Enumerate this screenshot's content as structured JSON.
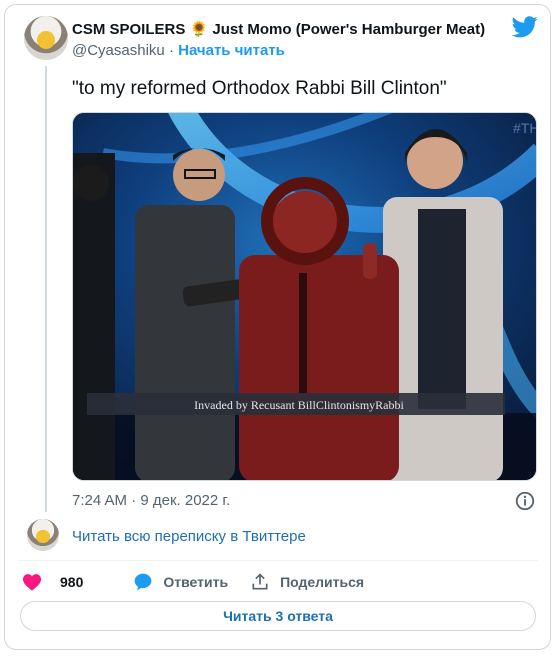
{
  "author": {
    "display_name": "CSM SPOILERS 🌻 Just Momo (Power's Hamburger Meat)",
    "handle": "@Cyasashiku",
    "separator": "·",
    "follow_label": "Начать читать"
  },
  "tweet": {
    "text": "\"to my reformed Orthodox Rabbi Bill Clinton\"",
    "media": {
      "corner_text": "#TH",
      "caption": "Invaded by Recusant BillClintonismyRabbi"
    },
    "timestamp": "7:24 AM · 9 дек. 2022 г."
  },
  "thread": {
    "read_label": "Читать всю переписку в Твиттере"
  },
  "actions": {
    "like_count": "980",
    "reply_label": "Ответить",
    "share_label": "Поделиться"
  },
  "replies_button": {
    "label": "Читать 3 ответа"
  },
  "colors": {
    "brand_blue": "#1d9bf0",
    "link_blue": "#1d6fb3",
    "like_pink": "#f91880",
    "muted": "#536471"
  },
  "icons": [
    "twitter-bird-icon",
    "info-icon",
    "heart-icon",
    "reply-icon",
    "share-icon"
  ]
}
